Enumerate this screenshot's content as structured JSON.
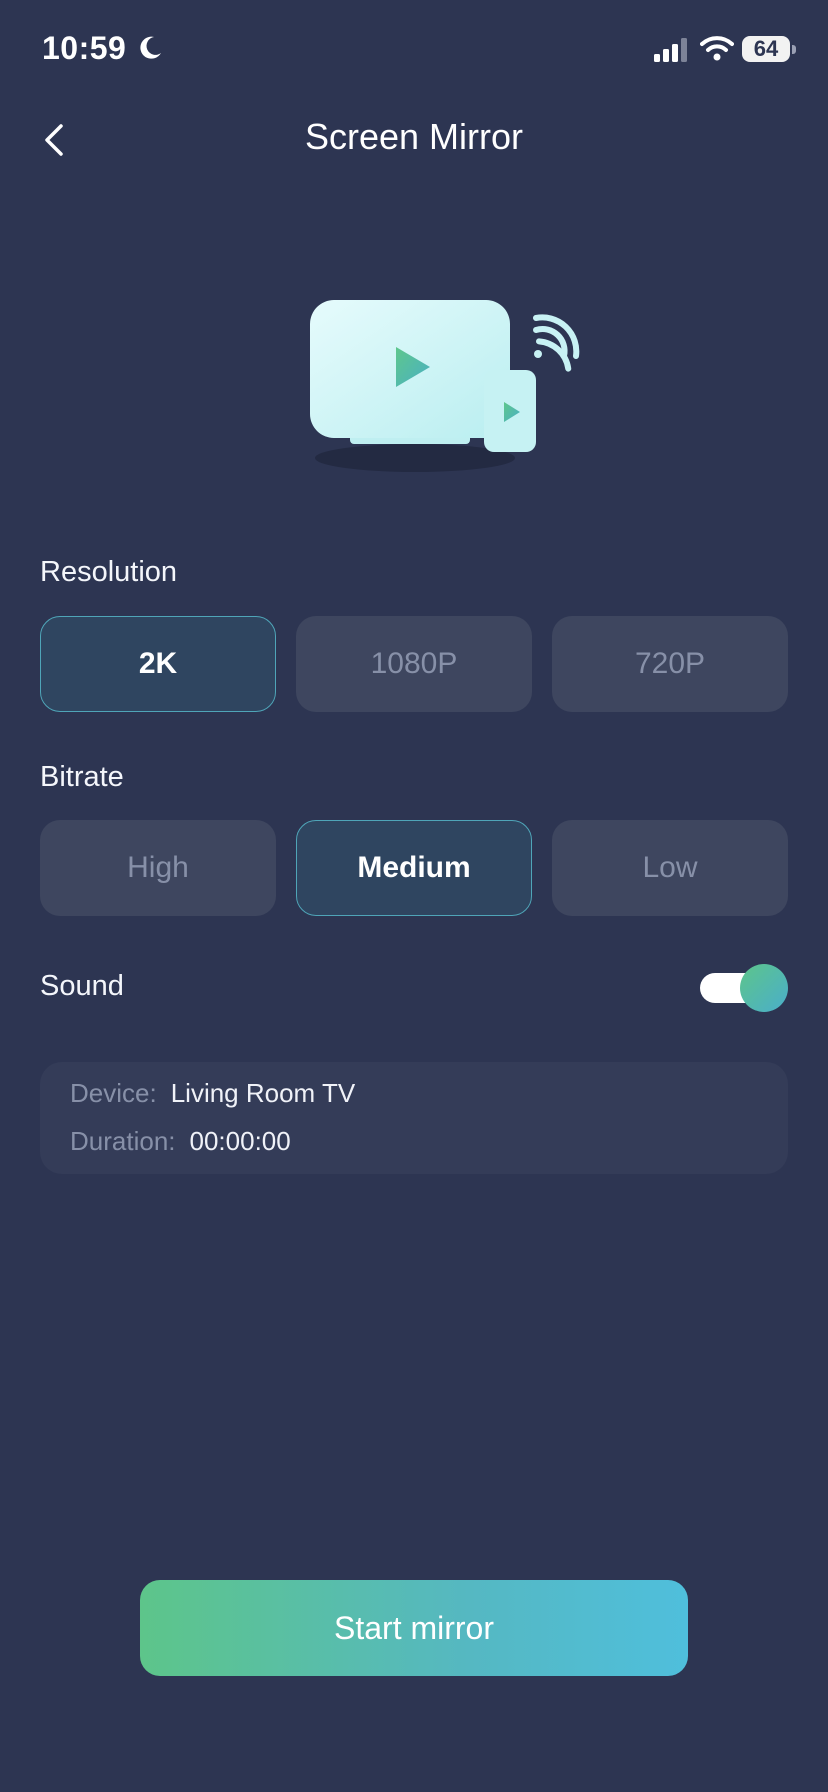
{
  "status_bar": {
    "time": "10:59",
    "battery": "64"
  },
  "header": {
    "title": "Screen Mirror"
  },
  "resolution": {
    "label": "Resolution",
    "options": [
      "2K",
      "1080P",
      "720P"
    ],
    "selected": "2K"
  },
  "bitrate": {
    "label": "Bitrate",
    "options": [
      "High",
      "Medium",
      "Low"
    ],
    "selected": "Medium"
  },
  "sound": {
    "label": "Sound",
    "enabled": true
  },
  "info": {
    "device_key": "Device:",
    "device_value": "Living Room TV",
    "duration_key": "Duration:",
    "duration_value": "00:00:00"
  },
  "start_button": {
    "label": "Start mirror"
  },
  "colors": {
    "background": "#2d3552",
    "accent_start": "#5dc58a",
    "accent_end": "#4fbfdc",
    "selected_border": "#4fa5b8"
  }
}
